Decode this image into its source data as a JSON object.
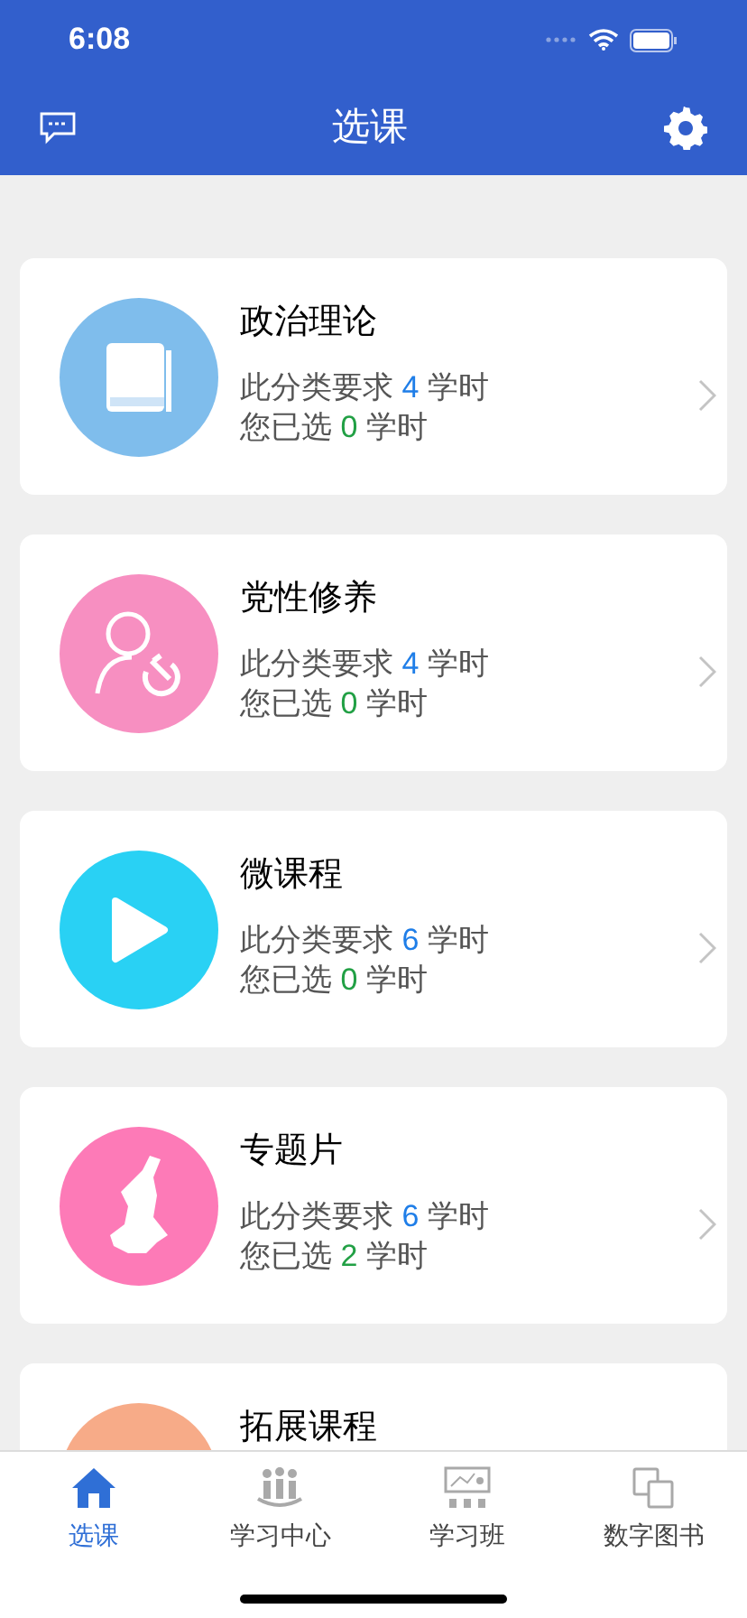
{
  "status_bar": {
    "time": "6:08"
  },
  "nav_bar": {
    "title": "选课"
  },
  "categories": [
    {
      "kind": "book",
      "color": "#7fbdec",
      "title": "政治理论",
      "required_label": "此分类要求",
      "required_hours": "4",
      "required_unit": "学时",
      "selected_label": "您已选",
      "selected_hours": "0",
      "selected_unit": "学时"
    },
    {
      "kind": "member",
      "color": "#f78fc1",
      "title": "党性修养",
      "required_label": "此分类要求",
      "required_hours": "4",
      "required_unit": "学时",
      "selected_label": "您已选",
      "selected_hours": "0",
      "selected_unit": "学时"
    },
    {
      "kind": "play",
      "color": "#29d1f4",
      "title": "微课程",
      "required_label": "此分类要求",
      "required_hours": "6",
      "required_unit": "学时",
      "selected_label": "您已选",
      "selected_hours": "0",
      "selected_unit": "学时"
    },
    {
      "kind": "map",
      "color": "#fd7ab7",
      "title": "专题片",
      "required_label": "此分类要求",
      "required_hours": "6",
      "required_unit": "学时",
      "selected_label": "您已选",
      "selected_hours": "2",
      "selected_unit": "学时"
    },
    {
      "kind": "blank",
      "color": "#f7ab88",
      "title": "拓展课程"
    }
  ],
  "tab_bar": [
    {
      "kind": "home",
      "label": "选课",
      "selected": true
    },
    {
      "kind": "people",
      "label": "学习中心",
      "selected": false
    },
    {
      "kind": "class",
      "label": "学习班",
      "selected": false
    },
    {
      "kind": "books",
      "label": "数字图书",
      "selected": false
    }
  ]
}
